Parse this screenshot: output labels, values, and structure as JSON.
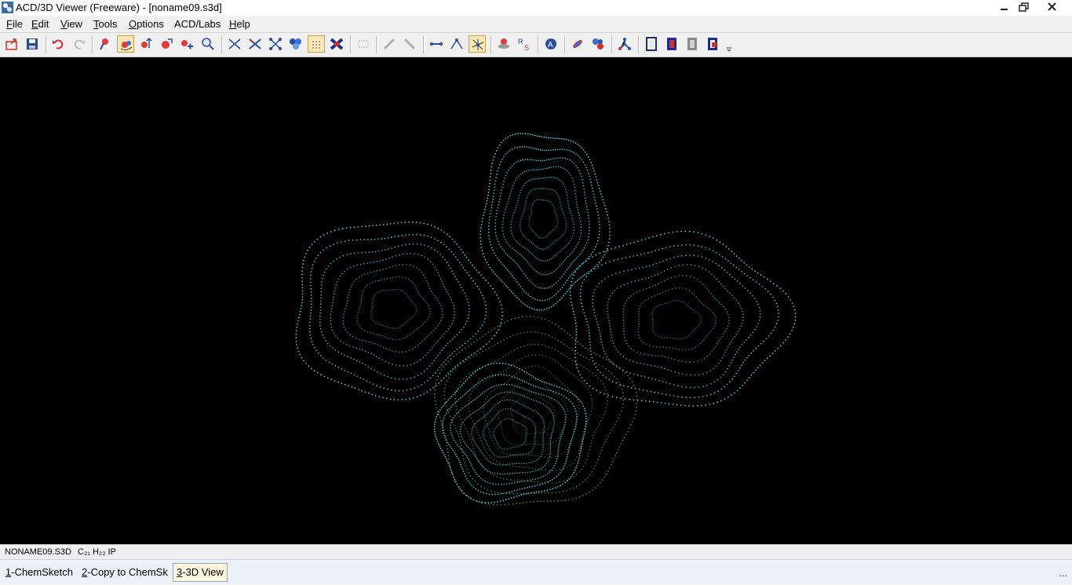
{
  "window": {
    "title": "ACD/3D Viewer (Freeware) - [noname09.s3d]"
  },
  "menu": [
    {
      "accel": "F",
      "rest": "ile"
    },
    {
      "accel": "E",
      "rest": "dit"
    },
    {
      "accel": "V",
      "rest": "iew"
    },
    {
      "accel": "T",
      "rest": "ools"
    },
    {
      "accel": "O",
      "rest": "ptions"
    },
    {
      "accel": "",
      "rest": "ACD/Labs"
    },
    {
      "accel": "H",
      "rest": "elp"
    }
  ],
  "toolbar": {
    "icons": [
      "open-icon",
      "save-icon",
      "undo-icon",
      "redo-icon",
      "select-atom-icon",
      "rotate-icon",
      "move-icon",
      "scale-icon",
      "translate-icon",
      "zoom-icon",
      "wireframe-icon",
      "sticks-icon",
      "ball-stick-icon",
      "spacefill-icon",
      "dot-surface-icon",
      "vdw-icon",
      "disabled-icon",
      "measure-distance-icon",
      "measure-angle-icon",
      "bond-icon",
      "angle-icon",
      "torsion-icon",
      "optimize-icon",
      "rs-stereo-icon",
      "atom-label-icon",
      "orbital-icon",
      "conformation-icon",
      "fragment-icon",
      "frame-icon",
      "film-icon",
      "film-gray-icon",
      "film-red-icon"
    ]
  },
  "status": {
    "filename": "NONAME09.S3D",
    "formula": "C₂₁ H₂₂ IP"
  },
  "tasks": [
    {
      "accel": "1",
      "rest": "-ChemSketch"
    },
    {
      "accel": "2",
      "rest": "-Copy to ChemSk"
    },
    {
      "accel": "3",
      "rest": "-3D View"
    }
  ],
  "taskbar_more": "...",
  "colors": {
    "surface_primary": "#5ad2e0",
    "surface_secondary": "#4a8a3a",
    "background": "#000000"
  }
}
